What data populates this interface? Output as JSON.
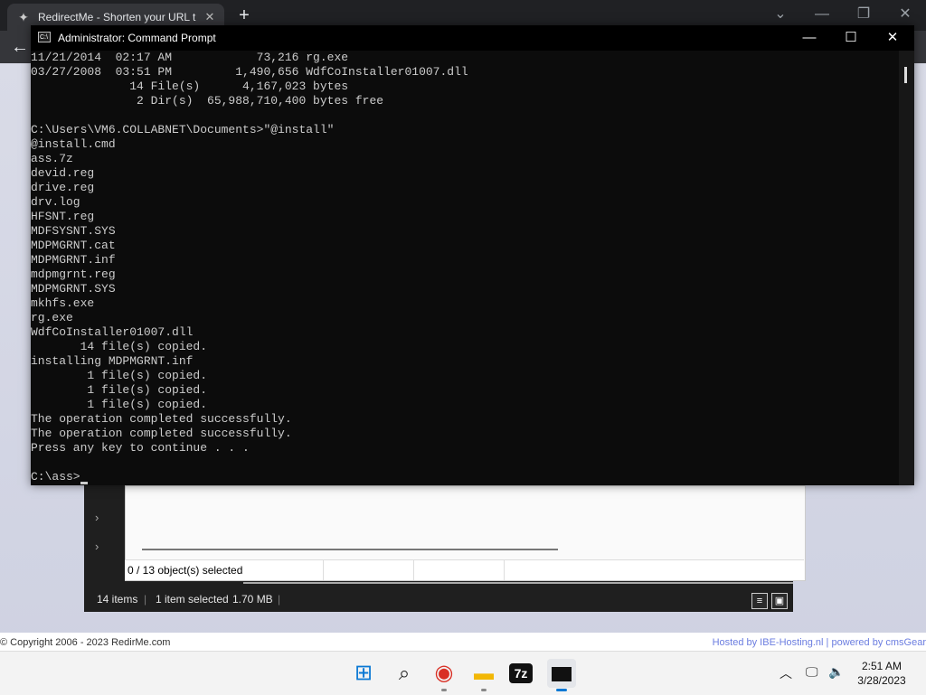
{
  "browser": {
    "tab_title": "RedirectMe - Shorten your URL t",
    "tab_favicon": "redirectme-logo-icon",
    "new_tab_label": "+",
    "back_label": "←"
  },
  "page": {
    "footer_copyright": "© Copyright 2006 - 2023 RedirMe.com",
    "footer_hosted": "Hosted by IBE-Hosting.nl | powered by cmsGear"
  },
  "cmd": {
    "title": "Administrator: Command Prompt",
    "icon_text": "C:\\",
    "minimize": "—",
    "maximize": "☐",
    "close": "✕",
    "lines": [
      "11/21/2014  02:17 AM            73,216 rg.exe",
      "03/27/2008  03:51 PM         1,490,656 WdfCoInstaller01007.dll",
      "              14 File(s)      4,167,023 bytes",
      "               2 Dir(s)  65,988,710,400 bytes free",
      "",
      "C:\\Users\\VM6.COLLABNET\\Documents>\"@install\"",
      "@install.cmd",
      "ass.7z",
      "devid.reg",
      "drive.reg",
      "drv.log",
      "HFSNT.reg",
      "MDFSYSNT.SYS",
      "MDPMGRNT.cat",
      "MDPMGRNT.inf",
      "mdpmgrnt.reg",
      "MDPMGRNT.SYS",
      "mkhfs.exe",
      "rg.exe",
      "WdfCoInstaller01007.dll",
      "       14 file(s) copied.",
      "installing MDPMGRNT.inf",
      "        1 file(s) copied.",
      "        1 file(s) copied.",
      "        1 file(s) copied.",
      "The operation completed successfully.",
      "The operation completed successfully.",
      "Press any key to continue . . .",
      ""
    ],
    "prompt": "C:\\ass>"
  },
  "explorer": {
    "status_selected": "0 / 13 object(s) selected",
    "items_count": "14 items",
    "item_selected": "1 item selected",
    "item_size": "1.70 MB"
  },
  "taskbar": {
    "apps": [
      {
        "name": "start-icon",
        "glyph": "⊞"
      },
      {
        "name": "search-icon",
        "glyph": "⌕"
      },
      {
        "name": "chrome-icon",
        "glyph": "◉"
      },
      {
        "name": "file-explorer-icon",
        "glyph": "▬"
      },
      {
        "name": "7zip-icon",
        "glyph": "7z"
      },
      {
        "name": "terminal-icon",
        "glyph": "▭"
      }
    ],
    "time": "2:51 AM",
    "date": "3/28/2023"
  }
}
